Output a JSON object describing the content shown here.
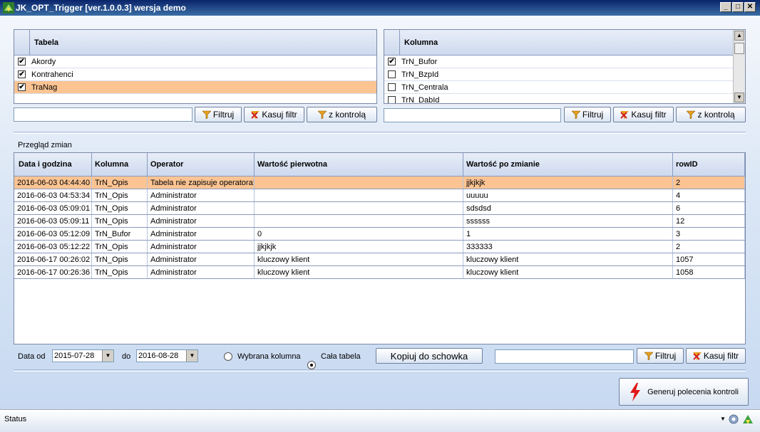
{
  "window": {
    "title": "JK_OPT_Trigger [ver.1.0.0.3]  wersja demo",
    "minimize": "_",
    "maximize": "□",
    "close": "✕"
  },
  "tables_grid": {
    "header": "Tabela",
    "rows": [
      {
        "label": "Akordy",
        "checked": "✔"
      },
      {
        "label": "Kontrahenci",
        "checked": "✔"
      },
      {
        "label": "TraNag",
        "checked": "✔"
      }
    ]
  },
  "columns_grid": {
    "header": "Kolumna",
    "rows": [
      {
        "label": "TrN_Bufor",
        "checked": "✔"
      },
      {
        "label": "TrN_BzpId",
        "checked": ""
      },
      {
        "label": "TrN_Centrala",
        "checked": ""
      },
      {
        "label": "TrN_DabId",
        "checked": ""
      }
    ]
  },
  "left_filter": {
    "value": "",
    "filter_label": "Filtruj",
    "clear_label": "Kasuj filtr",
    "control_label": "z kontrolą"
  },
  "right_filter": {
    "value": "",
    "filter_label": "Filtruj",
    "clear_label": "Kasuj filtr",
    "control_label": "z kontrolą"
  },
  "changes": {
    "section_label": "Przegląd zmian",
    "columns": [
      "Data i godzina",
      "Kolumna",
      "Operator",
      "Wartość pierwotna",
      "Wartość po zmianie",
      "rowID"
    ],
    "rows": [
      [
        "2016-06-03 04:44:40",
        "TrN_Opis",
        "Tabela nie zapisuje operatora!",
        "",
        "jjkjkjk",
        "2"
      ],
      [
        "2016-06-03 04:53:34",
        "TrN_Opis",
        "Administrator",
        "",
        "uuuuu",
        "4"
      ],
      [
        "2016-06-03 05:09:01",
        "TrN_Opis",
        "Administrator",
        "",
        "sdsdsd",
        "6"
      ],
      [
        "2016-06-03 05:09:11",
        "TrN_Opis",
        "Administrator",
        "",
        "ssssss",
        "12"
      ],
      [
        "2016-06-03 05:12:09",
        "TrN_Bufor",
        "Administrator",
        "0",
        "1",
        "3"
      ],
      [
        "2016-06-03 05:12:22",
        "TrN_Opis",
        "Administrator",
        "jjkjkjk",
        "333333",
        "2"
      ],
      [
        "2016-06-17 00:26:02",
        "TrN_Opis",
        "Administrator",
        "kluczowy klient",
        "kluczowy klient",
        "1057"
      ],
      [
        "2016-06-17 00:26:36",
        "TrN_Opis",
        "Administrator",
        "kluczowy klient",
        "kluczowy klient",
        "1058"
      ]
    ]
  },
  "bottom": {
    "date_from_label": "Data od",
    "date_from": "2015-07-28",
    "date_to_label": "do",
    "date_to": "2016-08-28",
    "radio_column": "Wybrana kolumna",
    "radio_table": "Cała tabela",
    "copy_label": "Kopiuj do schowka",
    "filter_value": "",
    "filter_label": "Filtruj",
    "clear_label": "Kasuj filtr"
  },
  "generate_label": "Generuj polecenia kontroli",
  "status": {
    "text": "Status"
  },
  "colors": {
    "selected_row": "#fcc493",
    "title_bar": "#0a246a"
  }
}
